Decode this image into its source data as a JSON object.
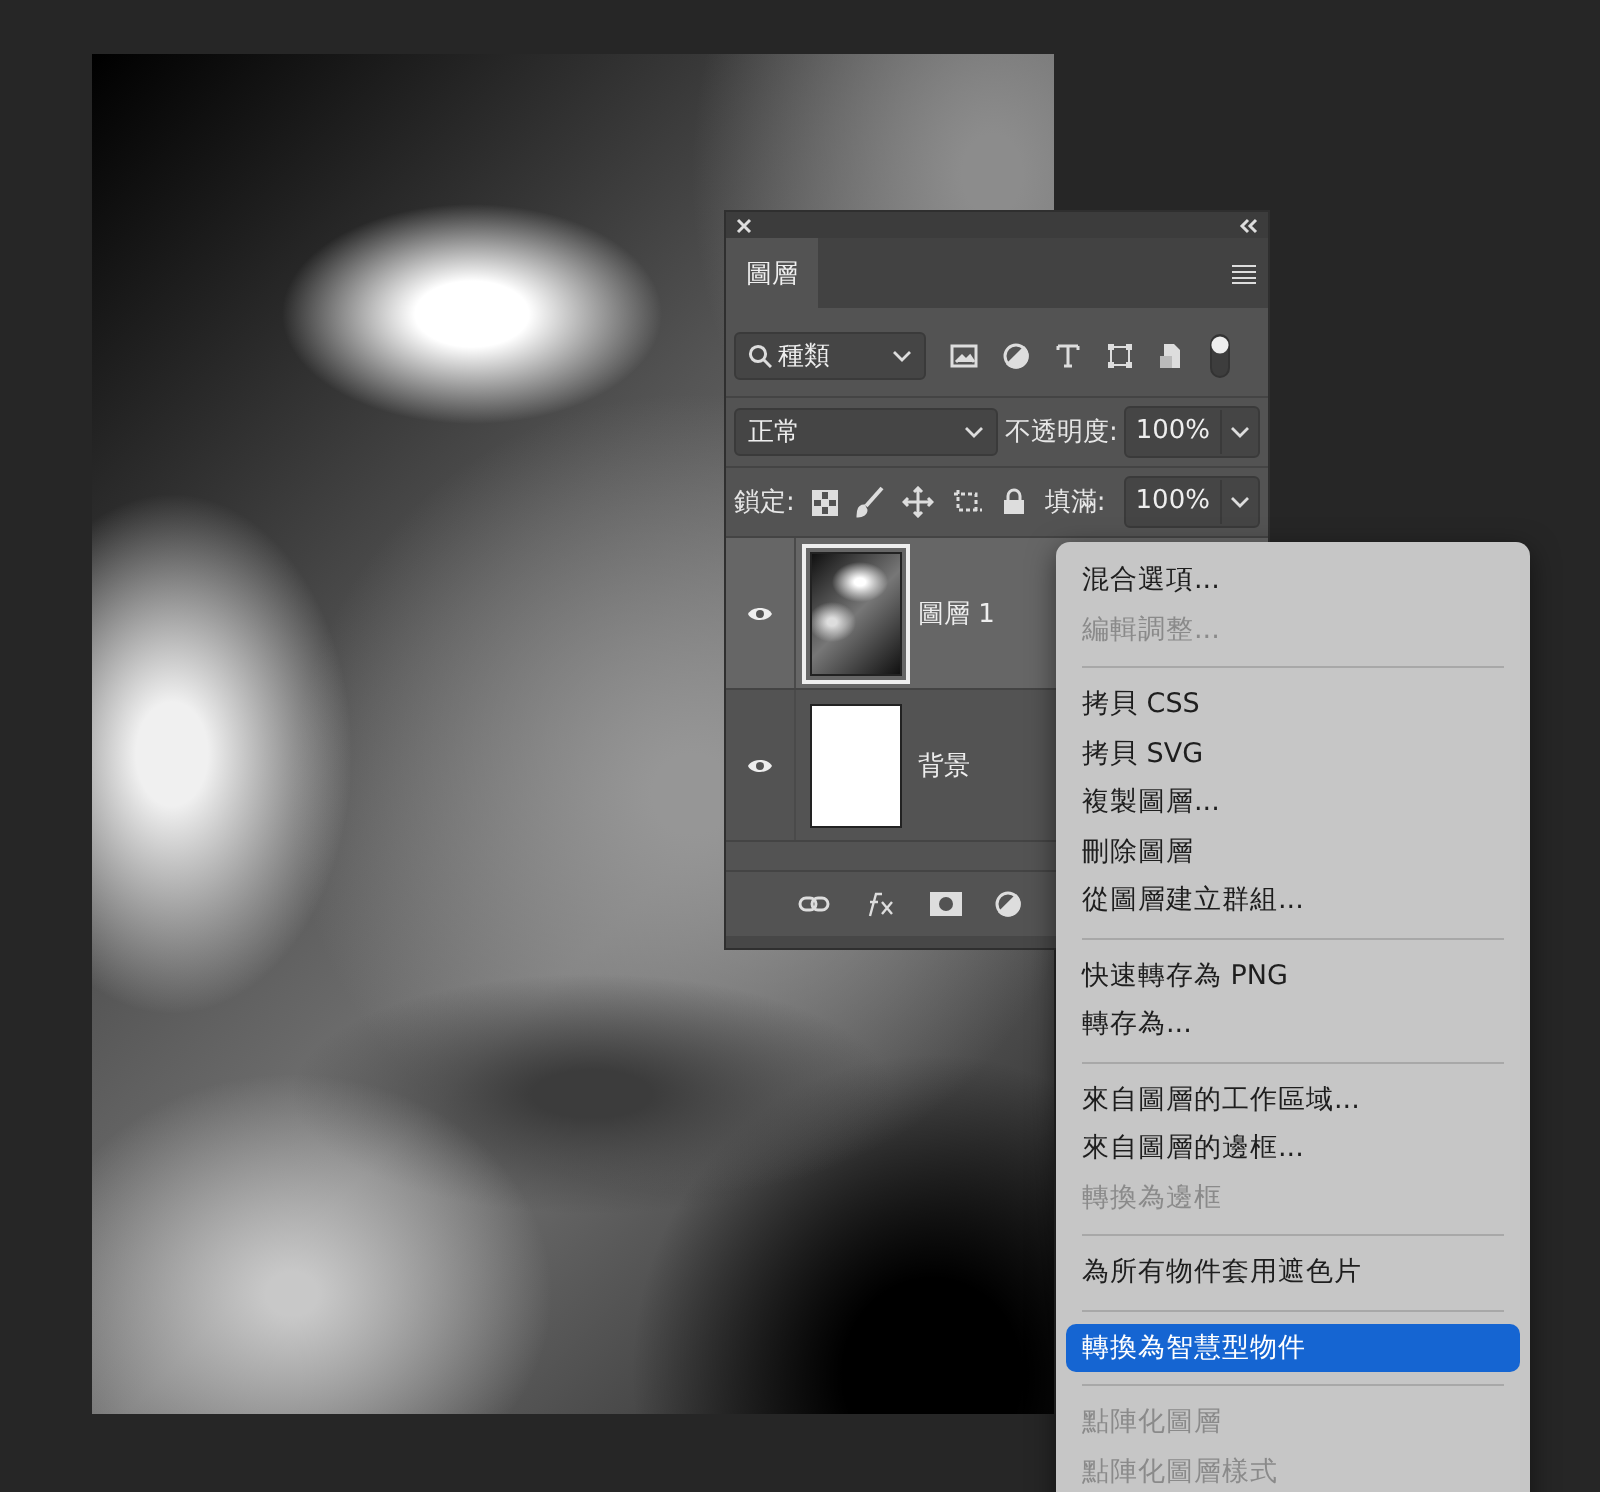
{
  "layers_panel": {
    "tabs": [
      {
        "label": "圖層",
        "selected": true
      }
    ],
    "filter": {
      "value": "種類",
      "on": true
    },
    "blend_mode": {
      "value": "正常"
    },
    "opacity": {
      "label": "不透明度:",
      "value": "100%"
    },
    "lock": {
      "label": "鎖定:"
    },
    "fill": {
      "label": "填滿:",
      "value": "100%"
    },
    "layers": [
      {
        "name": "圖層 1",
        "visible": true,
        "selected": true,
        "kind": "image"
      },
      {
        "name": "背景",
        "visible": true,
        "selected": false,
        "kind": "blank"
      }
    ]
  },
  "context_menu": {
    "items": [
      {
        "kind": "item",
        "label": "混合選項...",
        "disabled": false,
        "selected": false
      },
      {
        "kind": "item",
        "label": "編輯調整...",
        "disabled": true,
        "selected": false
      },
      {
        "kind": "separator"
      },
      {
        "kind": "item",
        "label": "拷貝 CSS",
        "disabled": false,
        "selected": false
      },
      {
        "kind": "item",
        "label": "拷貝 SVG",
        "disabled": false,
        "selected": false
      },
      {
        "kind": "item",
        "label": "複製圖層...",
        "disabled": false,
        "selected": false
      },
      {
        "kind": "item",
        "label": "刪除圖層",
        "disabled": false,
        "selected": false
      },
      {
        "kind": "item",
        "label": "從圖層建立群組...",
        "disabled": false,
        "selected": false
      },
      {
        "kind": "separator"
      },
      {
        "kind": "item",
        "label": "快速轉存為 PNG",
        "disabled": false,
        "selected": false
      },
      {
        "kind": "item",
        "label": "轉存為...",
        "disabled": false,
        "selected": false
      },
      {
        "kind": "separator"
      },
      {
        "kind": "item",
        "label": "來自圖層的工作區域...",
        "disabled": false,
        "selected": false
      },
      {
        "kind": "item",
        "label": "來自圖層的邊框...",
        "disabled": false,
        "selected": false
      },
      {
        "kind": "item",
        "label": "轉換為邊框",
        "disabled": true,
        "selected": false
      },
      {
        "kind": "separator"
      },
      {
        "kind": "item",
        "label": "為所有物件套用遮色片",
        "disabled": false,
        "selected": false
      },
      {
        "kind": "separator"
      },
      {
        "kind": "item",
        "label": "轉換為智慧型物件",
        "disabled": false,
        "selected": true
      },
      {
        "kind": "separator"
      },
      {
        "kind": "item",
        "label": "點陣化圖層",
        "disabled": true,
        "selected": false
      },
      {
        "kind": "item",
        "label": "點陣化圖層樣式",
        "disabled": true,
        "selected": false
      }
    ]
  }
}
